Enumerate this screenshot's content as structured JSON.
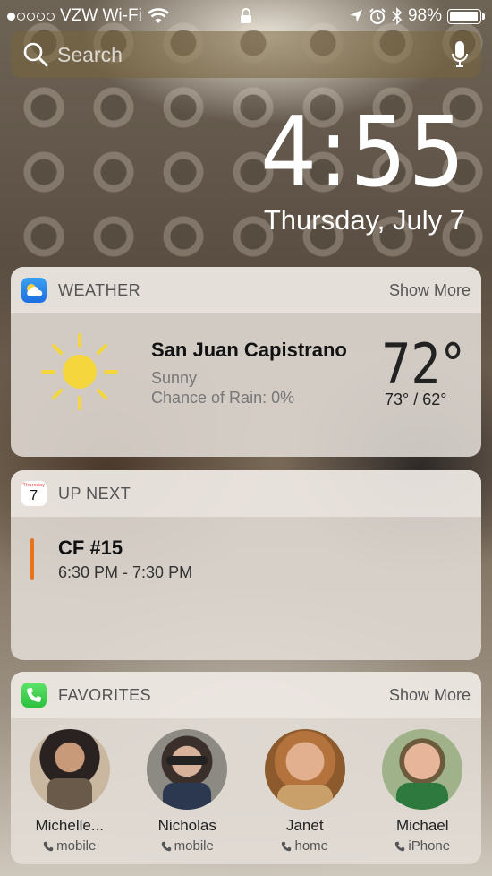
{
  "status_bar": {
    "carrier": "VZW Wi-Fi",
    "battery": "98%",
    "battery_level": 0.98,
    "signal_filled": 1,
    "signal_total": 5
  },
  "search": {
    "placeholder": "Search"
  },
  "lock_screen": {
    "time": "4:55",
    "date": "Thursday, July 7"
  },
  "weather_widget": {
    "title": "WEATHER",
    "show_more": "Show More",
    "city": "San Juan Capistrano",
    "condition": "Sunny",
    "rain": "Chance of Rain: 0%",
    "temp": "72°",
    "hilo": "73° / 62°",
    "icon": "sun-icon",
    "accent": "#f5d63c"
  },
  "upnext_widget": {
    "title": "UP NEXT",
    "calendar_day_label": "Thursday",
    "calendar_day_number": "7",
    "event_title": "CF #15",
    "event_time": "6:30 PM - 7:30 PM",
    "event_color": "#e8731f"
  },
  "favorites_widget": {
    "title": "FAVORITES",
    "show_more": "Show More",
    "contacts": [
      {
        "name": "Michelle...",
        "type": "mobile"
      },
      {
        "name": "Nicholas",
        "type": "mobile"
      },
      {
        "name": "Janet",
        "type": "home"
      },
      {
        "name": "Michael",
        "type": "iPhone"
      }
    ]
  }
}
